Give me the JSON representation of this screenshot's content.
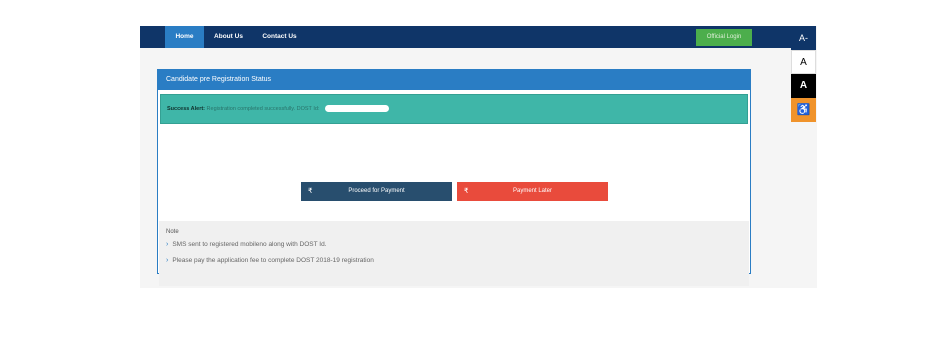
{
  "navbar": {
    "items": [
      "Home",
      "About Us",
      "Contact Us"
    ],
    "official_login": "Official Login"
  },
  "accessibility": {
    "decrease": "A-",
    "normal": "A",
    "contrast": "A",
    "icon": "wheelchair-icon"
  },
  "panel": {
    "heading": "Candidate pre Registration Status",
    "alert_label": "Success Alert:",
    "alert_message": "Registration completed successfully. DOST Id:",
    "buttons": {
      "proceed": "Proceed for Payment",
      "later": "Payment Later",
      "icon": "rupee-icon"
    },
    "note": {
      "title": "Note",
      "items": [
        "SMS sent to registered mobileno along with DOST Id.",
        "Please pay the application fee to complete DOST 2018-19 registration"
      ]
    }
  },
  "colors": {
    "navbar": "#0f3568",
    "primary": "#2a7dc4",
    "success": "#3fb6a8",
    "login": "#4cae4c",
    "danger": "#e94b3c",
    "dark_button": "#284e6e",
    "accessibility_orange": "#f0932b"
  }
}
